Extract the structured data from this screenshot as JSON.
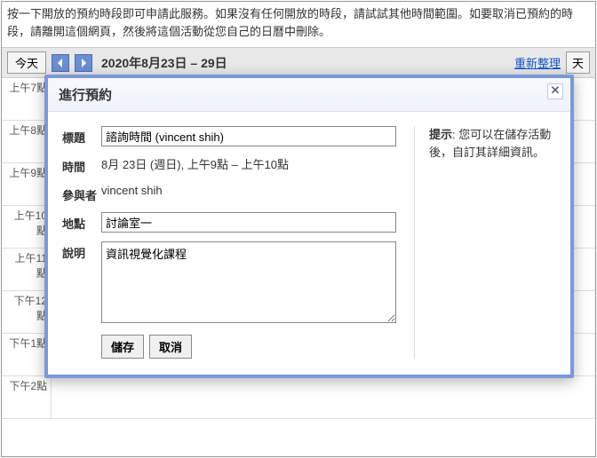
{
  "intro": "按一下開放的預約時段即可申請此服務。如果沒有任何開放的時段，請試試其他時間範圍。如要取消已預約的時段，請離開這個網頁，然後將這個活動從您自己的日曆中刪除。",
  "toolbar": {
    "today": "今天",
    "date_range": "2020年8月23日 – 29日",
    "refresh": "重新整理",
    "view_day": "天"
  },
  "time_slots": [
    "上午7點",
    "上午8點",
    "上午9點",
    "上午10點",
    "上午11點",
    "下午12點",
    "下午1點",
    "下午2點"
  ],
  "modal": {
    "title": "進行預約",
    "labels": {
      "title": "標題",
      "time": "時間",
      "attendee": "參與者",
      "location": "地點",
      "desc": "說明"
    },
    "values": {
      "title": "諮詢時間 (vincent shih)",
      "time": "8月 23日 (週日), 上午9點 – 上午10點",
      "attendee": "vincent shih",
      "location": "討論室一",
      "desc": "資訊視覺化課程"
    },
    "buttons": {
      "save": "儲存",
      "cancel": "取消"
    },
    "hint_label": "提示",
    "hint_text": ": 您可以在儲存活動後，自訂其詳細資訊。"
  }
}
